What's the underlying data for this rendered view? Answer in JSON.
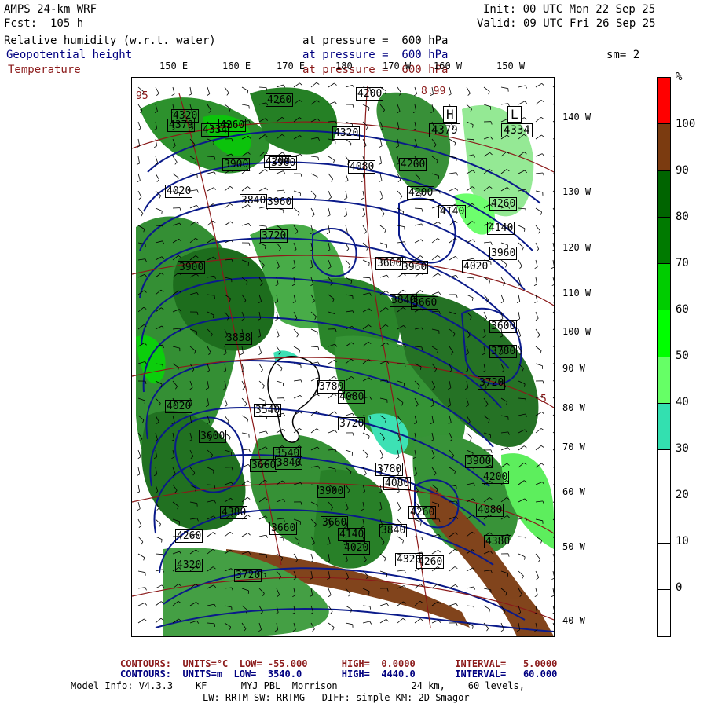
{
  "header": {
    "model": "AMPS 24-km WRF",
    "fcst": "Fcst:  105 h",
    "init": "Init: 00 UTC Mon 22 Sep 25",
    "valid": "Valid: 09 UTC Fri 26 Sep 25",
    "field1": "Relative humidity (w.r.t. water)",
    "field1_level": "at pressure =  600 hPa",
    "field2": "Geopotential height",
    "field2_level": "at pressure =  600 hPa",
    "field3": "Temperature",
    "field3_level": "at pressure =  600 hPa",
    "smooth": "sm= 2"
  },
  "top_lon_labels": [
    "150 E",
    "160 E",
    "170 E",
    "180",
    "170 W",
    "160 W",
    "150 W"
  ],
  "right_lon_labels": [
    "140 W",
    "130 W",
    "120 W",
    "110 W",
    "100 W",
    "90 W",
    "80 W",
    "70 W",
    "60 W",
    "50 W",
    "40 W"
  ],
  "colorbar": {
    "unit": "%",
    "ticks": [
      "100",
      "90",
      "80",
      "70",
      "60",
      "50",
      "40",
      "30",
      "20",
      "10",
      "0"
    ],
    "colors": [
      "#ff0000",
      "#7b3b10",
      "#006400",
      "#007a00",
      "#00cc00",
      "#00ff00",
      "#66ff66",
      "#33e0b0",
      "#ffffff",
      "#ffffff",
      "#ffffff",
      "#ffffff"
    ]
  },
  "height_labels": [
    "4260",
    "4320",
    "4200",
    "4379",
    "4334",
    "4260",
    "4320",
    "4200",
    "4080",
    "4260",
    "3900",
    "3960",
    "4020",
    "3840",
    "3960",
    "4140",
    "4260",
    "4200",
    "4140",
    "3960",
    "4020",
    "3720",
    "3960",
    "3900",
    "3600",
    "3840",
    "3660",
    "3600",
    "4080",
    "3858",
    "3780",
    "3540",
    "4020",
    "3720",
    "3660",
    "3600",
    "3840",
    "3900",
    "4080",
    "4260",
    "4140",
    "4320",
    "4380",
    "4260",
    "4320",
    "4020",
    "3780",
    "3720",
    "3900",
    "4200",
    "4380",
    "4080",
    "4260",
    "3840",
    "3660",
    "3720",
    "3660",
    "3780",
    "3540"
  ],
  "symbols": {
    "high": "H",
    "low": "L",
    "low_value": "4334",
    "high_value": "4379"
  },
  "temp_labels": [
    "95",
    "8.99",
    "5"
  ],
  "footer": {
    "temp_line": "CONTOURS:  UNITS=°C  LOW= -55.000      HIGH=  0.0000       INTERVAL=   5.0000",
    "height_line": "CONTOURS:  UNITS=m  LOW=  3540.0       HIGH=  4440.0       INTERVAL=   60.000",
    "model_info": "Model Info: V4.3.3    KF      MYJ PBL  Morrison             24 km,    60 levels,",
    "physics": "LW: RRTM SW: RRTMG   DIFF: simple KM: 2D Smagor"
  }
}
